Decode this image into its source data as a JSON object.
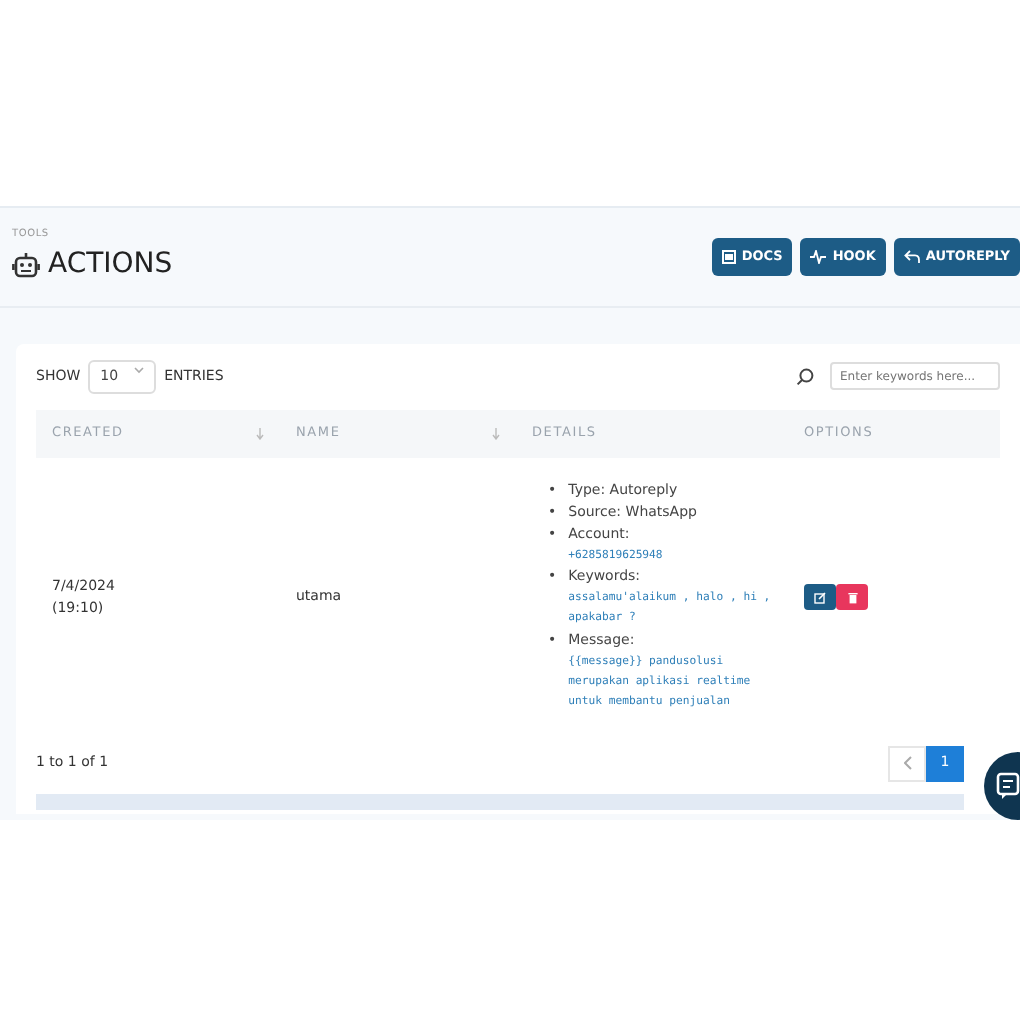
{
  "header": {
    "pretitle": "TOOLS",
    "title": "ACTIONS",
    "buttons": [
      {
        "label": "DOCS",
        "kind": "docs"
      },
      {
        "label": "HOOK",
        "kind": "hook"
      },
      {
        "label": "AUTOREPLY",
        "kind": "autoreply"
      }
    ]
  },
  "toolbar": {
    "show_label": "SHOW",
    "page_size": "10",
    "entries_label": "ENTRIES",
    "search": {
      "placeholder": "Enter keywords here..."
    }
  },
  "table": {
    "columns": [
      "CREATED",
      "NAME",
      "DETAILS",
      "OPTIONS"
    ],
    "rows": [
      {
        "created": [
          "7/4/2024",
          "(19:10)"
        ],
        "name": "utama",
        "details": [
          {
            "marker": "•",
            "label": "Type: Autoreply"
          },
          {
            "marker": "•",
            "label": "Source: WhatsApp"
          },
          {
            "marker": "•",
            "label": "Account:",
            "value": "+6285819625948"
          },
          {
            "marker": "•",
            "label": "Keywords:",
            "value": "assalamu'alaikum , halo , hi , apakabar ?"
          },
          {
            "marker": "•",
            "label": "Message:",
            "value": "{{message}} pandusolusi merupakan aplikasi realtime untuk membantu penjualan"
          }
        ]
      }
    ]
  },
  "footer": {
    "summary": "1 to 1 of 1",
    "pages": [
      {
        "label": "1",
        "selected": true
      }
    ]
  }
}
